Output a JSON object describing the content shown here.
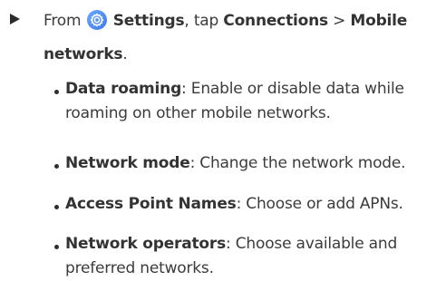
{
  "step": {
    "prefix": "From ",
    "settings_label": "Settings",
    "middle": ", tap ",
    "connections_label": "Connections",
    "separator": " > ",
    "mobile_networks_label": "Mobile networks",
    "suffix": ".",
    "icon_color": "#4c8cf5"
  },
  "bullets": [
    {
      "term": "Data roaming",
      "description": ": Enable or disable data while roaming on other mobile networks."
    },
    {
      "term": "Network mode",
      "description": ": Change the network mode."
    },
    {
      "term": "Access Point Names",
      "description": ": Choose or add APNs."
    },
    {
      "term": "Network operators",
      "description": ": Choose available and preferred networks."
    }
  ]
}
